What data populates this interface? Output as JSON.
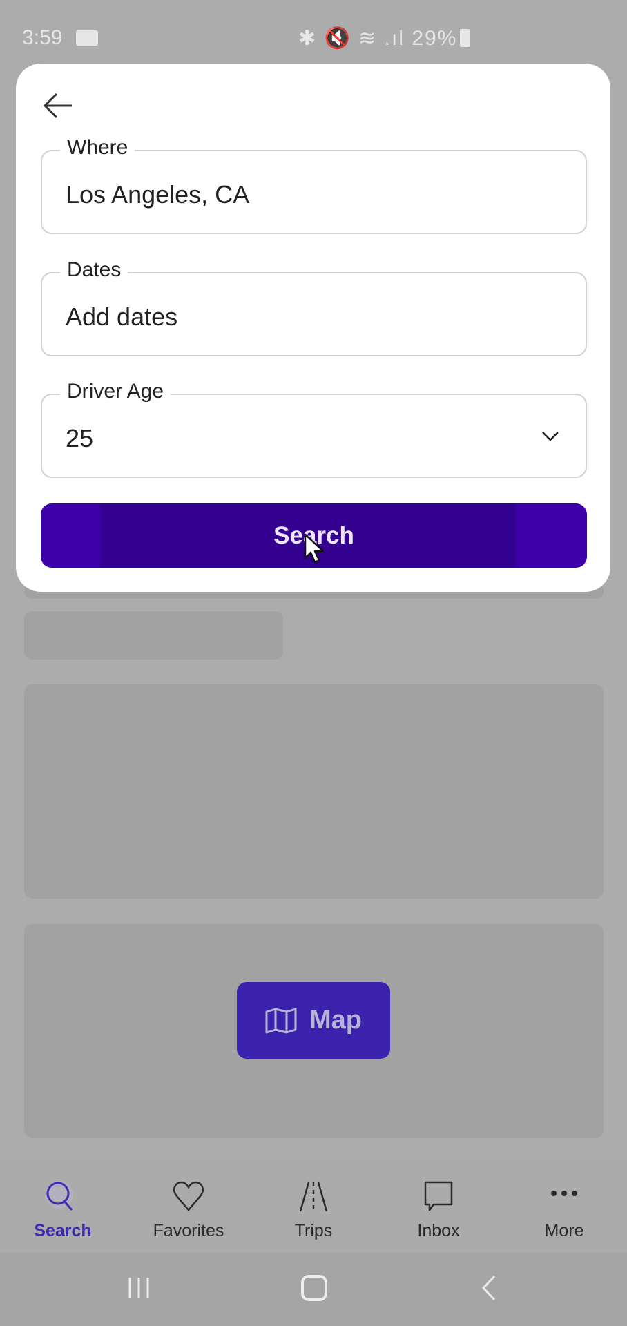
{
  "status_bar": {
    "time": "3:59",
    "indicators": "✱ 🔇 ≋ .ıl",
    "battery": "29%"
  },
  "form": {
    "where": {
      "label": "Where",
      "value": "Los Angeles, CA"
    },
    "dates": {
      "label": "Dates",
      "placeholder": "Add dates"
    },
    "driver_age": {
      "label": "Driver Age",
      "value": "25"
    },
    "search_label": "Search"
  },
  "map_button": {
    "label": "Map"
  },
  "bottom_nav": {
    "items": [
      {
        "label": "Search",
        "icon": "search-icon",
        "active": true
      },
      {
        "label": "Favorites",
        "icon": "heart-icon"
      },
      {
        "label": "Trips",
        "icon": "road-icon"
      },
      {
        "label": "Inbox",
        "icon": "chat-bubble-icon"
      },
      {
        "label": "More",
        "icon": "more-dots-icon"
      }
    ]
  },
  "colors": {
    "accent": "#3d00a8",
    "active_nav": "#3d2cb0",
    "overlay": "#acacac"
  }
}
